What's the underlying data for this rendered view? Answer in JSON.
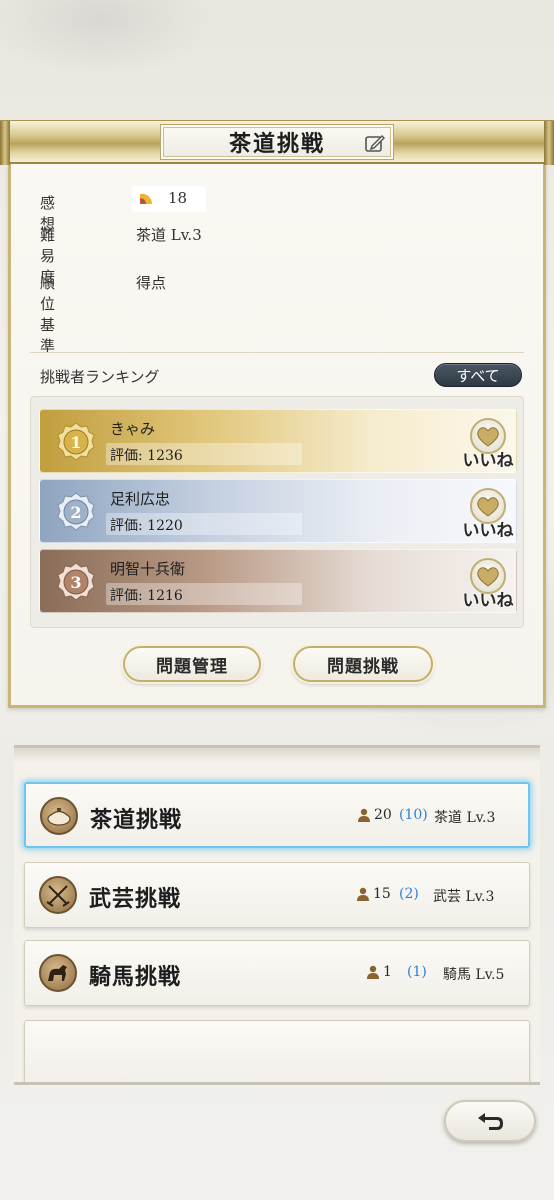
{
  "header": {
    "title": "茶道挑戦"
  },
  "info": {
    "impression_label": "感想",
    "impression_value": "18",
    "difficulty_label": "難易度",
    "difficulty_value": "茶道 Lv.3",
    "ranking_basis_label": "順位基準",
    "ranking_basis_value": "得点"
  },
  "ranking": {
    "title": "挑戦者ランキング",
    "all_button": "すべて",
    "like_label": "いいね",
    "entries": [
      {
        "rank": "1",
        "name": "きゃみ",
        "score": "評価: 1236"
      },
      {
        "rank": "2",
        "name": "足利広忠",
        "score": "評価: 1220"
      },
      {
        "rank": "3",
        "name": "明智十兵衛",
        "score": "評価: 1216"
      }
    ]
  },
  "actions": {
    "manage": "問題管理",
    "challenge": "問題挑戦"
  },
  "challenges": [
    {
      "title": "茶道挑戦",
      "count": "20",
      "sub": "(10)",
      "level": "茶道 Lv.3",
      "icon": "tea-bowl-icon"
    },
    {
      "title": "武芸挑戦",
      "count": "15",
      "sub": "(2)",
      "level": "武芸 Lv.3",
      "icon": "crossed-swords-icon"
    },
    {
      "title": "騎馬挑戦",
      "count": "1",
      "sub": "(1)",
      "level": "騎馬 Lv.5",
      "icon": "horse-icon"
    }
  ],
  "colors": {
    "gold": "#c19e3e",
    "silver": "#8fa4c0",
    "bronze": "#8a6d58",
    "accent_blue": "#2f7fd8",
    "selected_glow": "#6ec6f0"
  }
}
